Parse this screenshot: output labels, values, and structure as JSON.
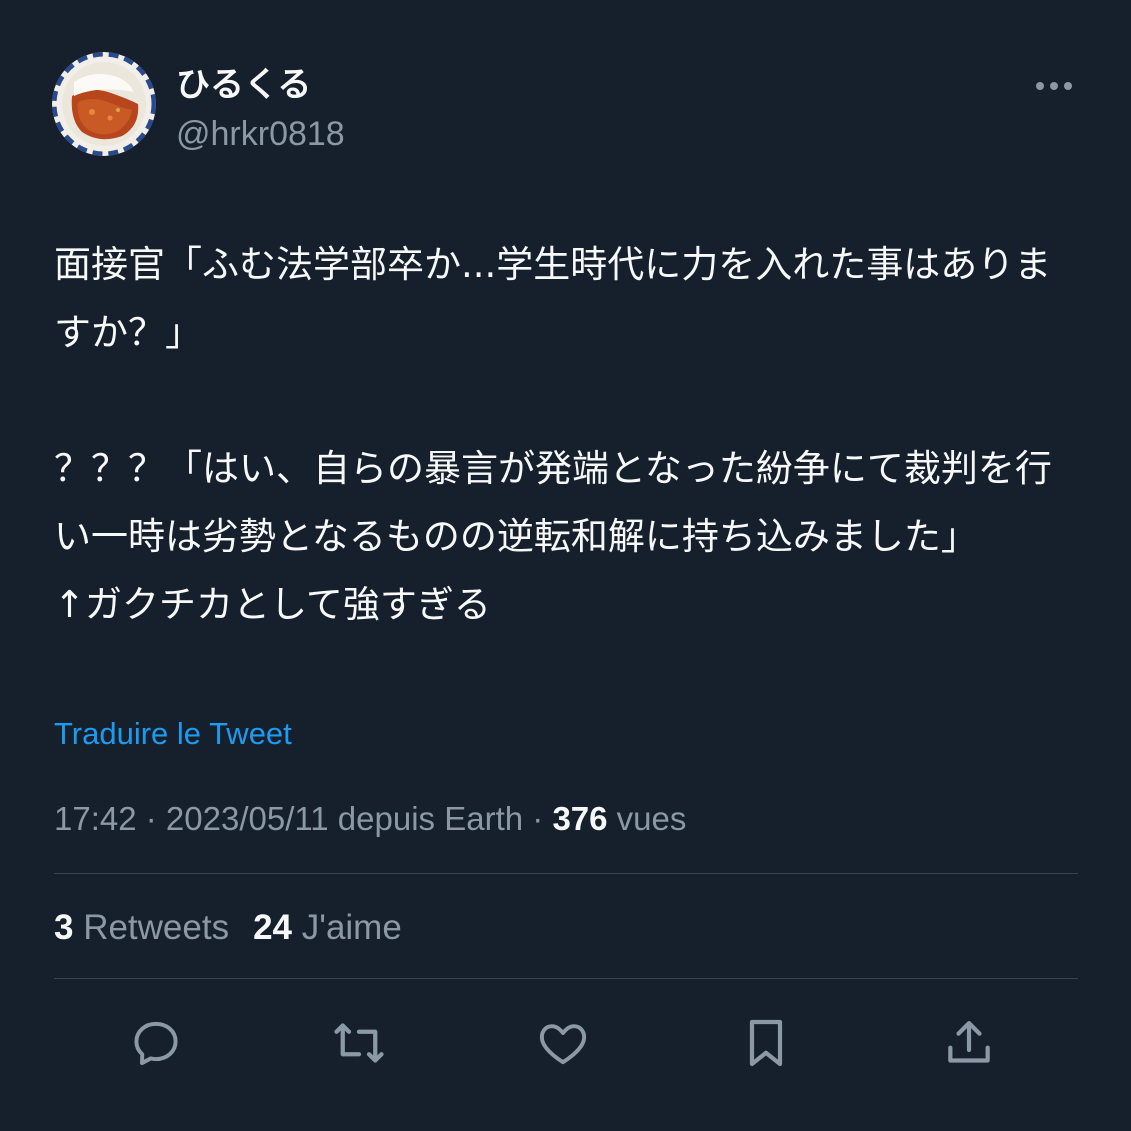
{
  "author": {
    "display_name": "ひるくる",
    "handle": "@hrkr0818"
  },
  "tweet": {
    "lines": [
      "面接官「ふむ法学部卒か...学生時代に力を入れた事はありま",
      "すか？」",
      "",
      "？？？「はい、自らの暴言が発端となった紛争にて裁判を行",
      "い一時は劣勢となるものの逆転和解に持ち込みました」",
      "↑ガクチカとして強すぎる"
    ]
  },
  "translate_label": "Traduire le Tweet",
  "meta": {
    "time": "17:42",
    "sep1": " · ",
    "date": "2023/05/11",
    "source": " depuis Earth",
    "sep2": " · ",
    "views_count": "376",
    "views_label": " vues"
  },
  "stats": {
    "retweets_count": "3",
    "retweets_label": " Retweets",
    "likes_count": "24",
    "likes_label": " J'aime"
  },
  "icons": {
    "more": "more-horizontal-icon",
    "reply": "reply-icon",
    "retweet": "retweet-icon",
    "like": "heart-icon",
    "bookmark": "bookmark-icon",
    "share": "share-icon"
  },
  "colors": {
    "background": "#16202c",
    "text": "#f7f9f9",
    "secondary": "#8b98a5",
    "link": "#1d9bf0",
    "divider": "#38444d"
  }
}
